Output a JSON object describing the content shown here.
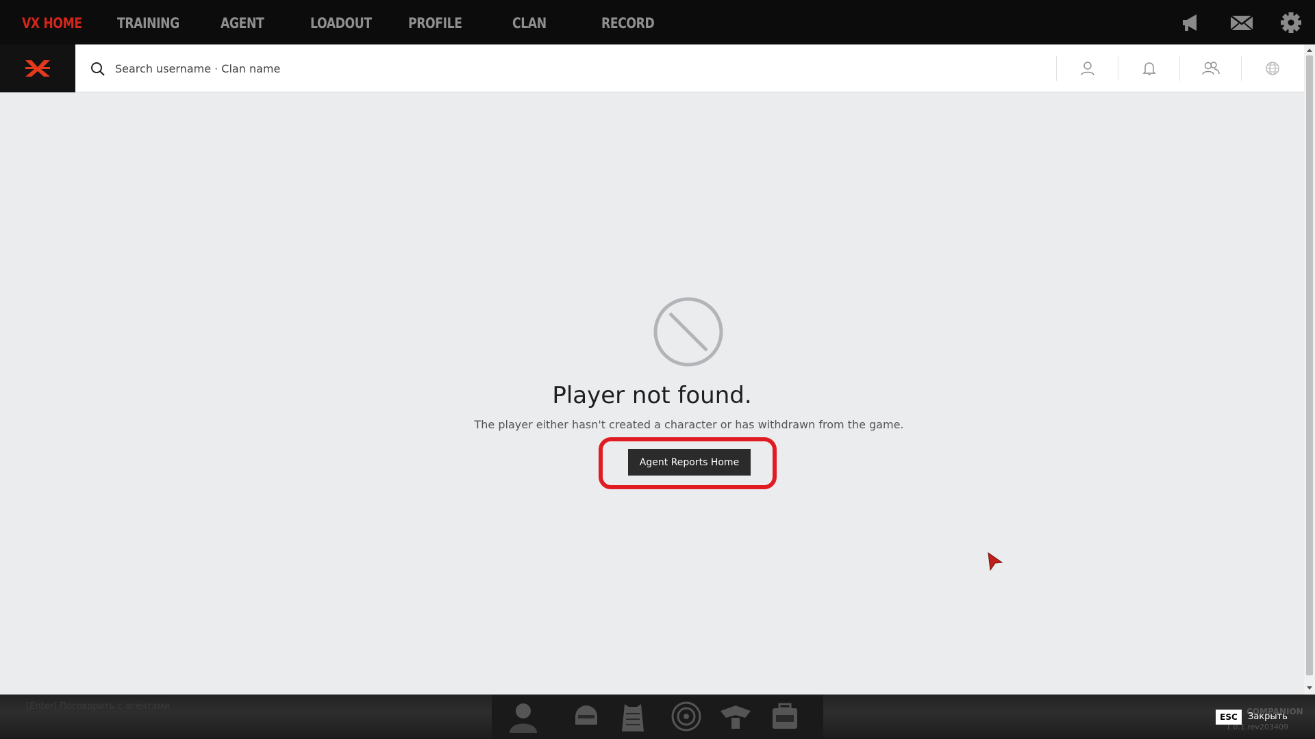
{
  "game_nav": {
    "items": [
      {
        "label": "VX HOME",
        "active": true
      },
      {
        "label": "TRAINING",
        "active": false
      },
      {
        "label": "AGENT",
        "active": false
      },
      {
        "label": "LOADOUT",
        "active": false
      },
      {
        "label": "PROFILE",
        "active": false
      },
      {
        "label": "CLAN",
        "active": false
      },
      {
        "label": "RECORD",
        "active": false
      }
    ],
    "tools": [
      "megaphone-icon",
      "mail-icon",
      "settings-icon"
    ]
  },
  "header": {
    "search_placeholder": "Search username · Clan name",
    "buttons": [
      "user-icon",
      "bell-icon",
      "friends-icon",
      "globe-icon"
    ]
  },
  "main": {
    "title": "Player not found.",
    "subtitle": "The player either hasn't created a character or has withdrawn from the game.",
    "button_label": "Agent Reports Home"
  },
  "bottom": {
    "hint": "[Enter] Поговорить с агентами",
    "esc_key": "ESC",
    "close_label": "Закрыть",
    "app_name": "COMPANION",
    "version": "1.0.1.rev203409"
  },
  "colors": {
    "accent": "#d2261b",
    "highlight": "#e11b22",
    "page_bg": "#ebecee",
    "button_bg": "#2b2b2b"
  }
}
